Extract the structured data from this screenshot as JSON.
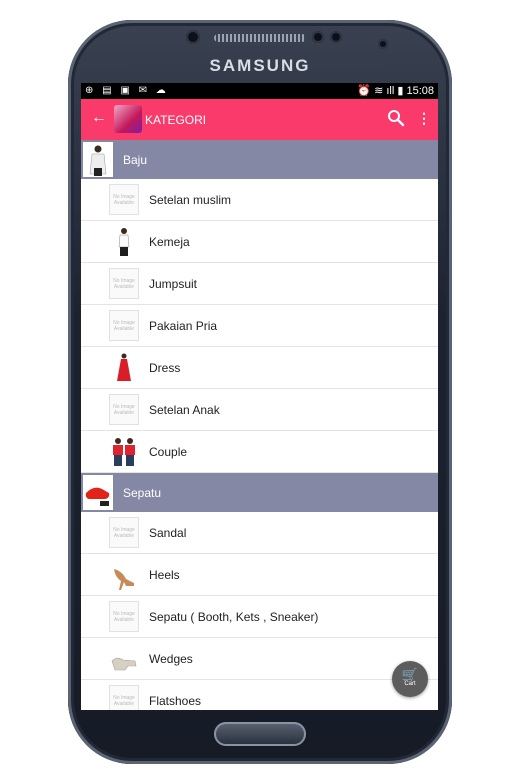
{
  "device": {
    "brand": "SAMSUNG"
  },
  "status_bar": {
    "left_icons": "⊕ ▤ ▣ ✉ ☁",
    "right": "⏰ ≋ ıll ▮ 15:08"
  },
  "app_bar": {
    "title": "KATEGORI",
    "back_icon": "←",
    "more_icon": "⋮"
  },
  "sections": [
    {
      "title": "Baju",
      "items": [
        {
          "label": "Setelan muslim",
          "image": "no-image"
        },
        {
          "label": "Kemeja",
          "image": "photo"
        },
        {
          "label": "Jumpsuit",
          "image": "no-image"
        },
        {
          "label": "Pakaian Pria",
          "image": "no-image"
        },
        {
          "label": "Dress",
          "image": "photo"
        },
        {
          "label": "Setelan Anak",
          "image": "no-image"
        },
        {
          "label": "Couple",
          "image": "photo"
        }
      ]
    },
    {
      "title": "Sepatu",
      "items": [
        {
          "label": "Sandal",
          "image": "no-image"
        },
        {
          "label": "Heels",
          "image": "photo"
        },
        {
          "label": "Sepatu ( Booth, Kets , Sneaker)",
          "image": "no-image"
        },
        {
          "label": "Wedges",
          "image": "photo"
        },
        {
          "label": "Flatshoes",
          "image": "no-image"
        }
      ]
    }
  ],
  "no_image_text": "No Image Available",
  "cart_fab": {
    "label": "Cart",
    "icon": "🛒"
  },
  "colors": {
    "app_bar": "#fb3a6c",
    "section_header": "#8488a4",
    "fab": "#5d5d5d"
  }
}
